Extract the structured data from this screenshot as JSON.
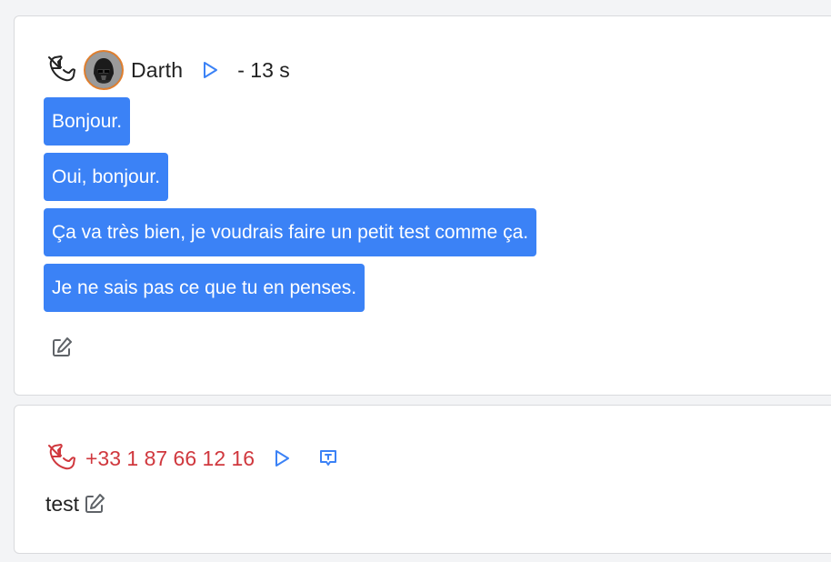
{
  "calls": [
    {
      "direction_icon": "phone-incoming-icon",
      "caller": "Darth",
      "duration": "- 13 s",
      "colors": {
        "icon": "#222222",
        "avatar_border": "#e07f2f",
        "bubble": "#3b82f6",
        "play": "#3b82f6"
      },
      "transcript": [
        "Bonjour.",
        "Oui, bonjour.",
        "Ça va très bien, je voudrais faire un petit test comme ça.",
        "Je ne sais pas ce que tu en penses."
      ]
    },
    {
      "direction_icon": "phone-missed-icon",
      "phone_number": "+33 1 87 66 12 16",
      "note": "test",
      "colors": {
        "icon": "#d0383e",
        "number": "#d0383e",
        "play": "#3b82f6",
        "transcript_icon": "#3b82f6"
      }
    }
  ]
}
